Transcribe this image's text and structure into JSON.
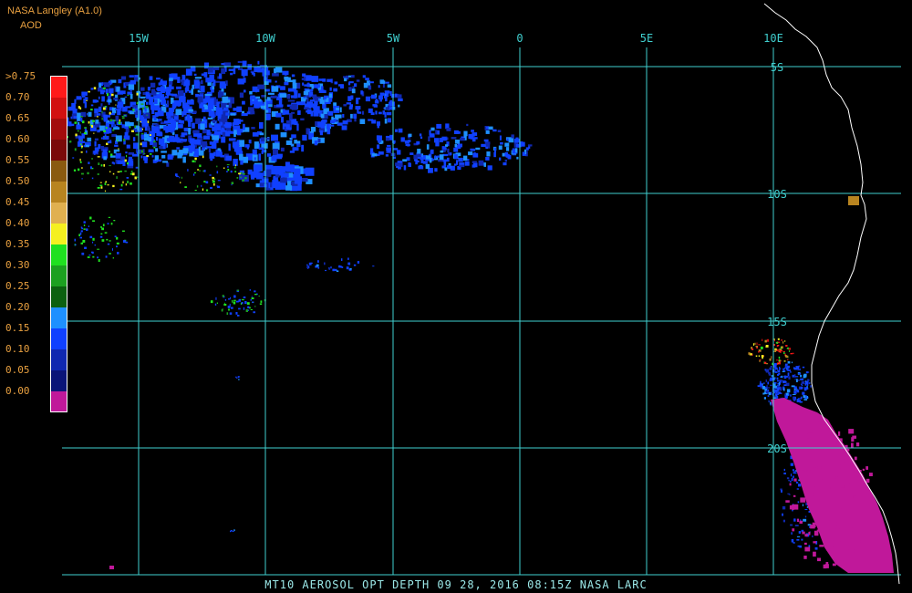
{
  "header": {
    "source": "NASA Langley (A1.0)",
    "product": "AOD"
  },
  "legend": {
    "labels": [
      ">0.75",
      "0.70",
      "0.65",
      "0.60",
      "0.55",
      "0.50",
      "0.45",
      "0.40",
      "0.35",
      "0.30",
      "0.25",
      "0.20",
      "0.15",
      "0.10",
      "0.05",
      "0.00"
    ],
    "colors": [
      "#ff1a1a",
      "#d21010",
      "#a30c0c",
      "#7a0a0a",
      "#8a5a10",
      "#b88420",
      "#e0b050",
      "#f5f020",
      "#20e020",
      "#1ca020",
      "#0c6010",
      "#1e90ff",
      "#1040ff",
      "#1028b0",
      "#0a1478",
      "#c0189a"
    ]
  },
  "map": {
    "longitude_labels": [
      "15W",
      "10W",
      "5W",
      "0",
      "5E",
      "10E"
    ],
    "latitude_labels": [
      "5S",
      "10S",
      "15S",
      "20S"
    ],
    "grid_color": "#40d0d0",
    "coast_color": "#ffffff",
    "ocean_color": "#000000"
  },
  "footer": {
    "text": "MT10  AEROSOL OPT DEPTH   09 28, 2016 08:15Z   NASA LARC"
  }
}
